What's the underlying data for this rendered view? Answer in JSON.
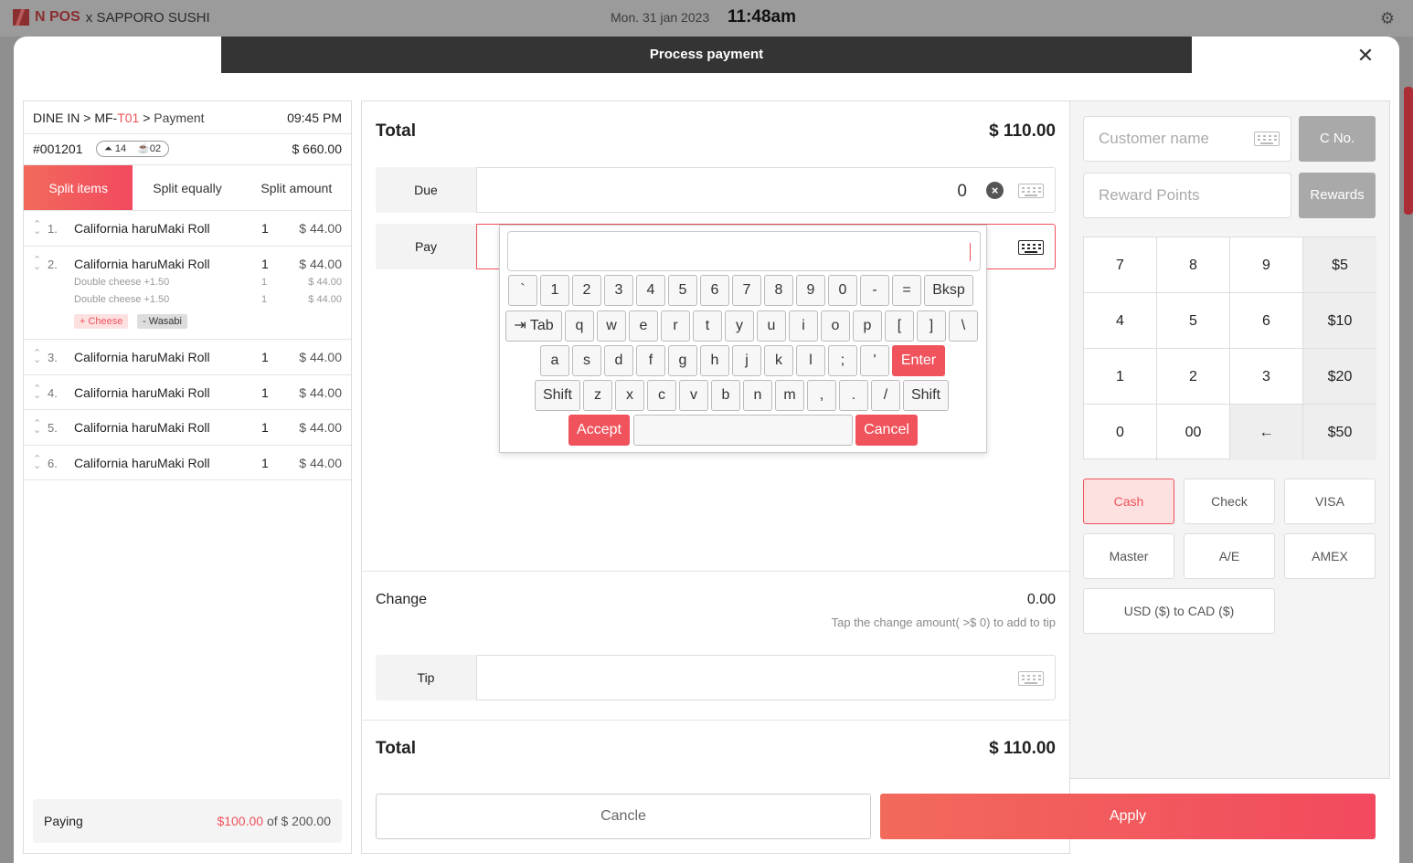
{
  "topbar": {
    "brand": "N POS",
    "restaurant": "x SAPPORO SUSHI",
    "date": "Mon. 31 jan 2023",
    "time": "11:48am"
  },
  "modal": {
    "title": "Process payment"
  },
  "order": {
    "breadcrumb": {
      "type": "DINE IN",
      "table_prefix": "MF-",
      "table": "T01",
      "page": "Payment"
    },
    "time": "09:45 PM",
    "number": "#001201",
    "guests": "14",
    "seats": "02",
    "total": "$ 660.00"
  },
  "tabs": [
    {
      "label": "Split items"
    },
    {
      "label": "Split equally"
    },
    {
      "label": "Split amount"
    }
  ],
  "items": [
    {
      "idx": "1.",
      "name": "California haruMaki Roll",
      "qty": "1",
      "price": "$ 44.00"
    },
    {
      "idx": "2.",
      "name": "California haruMaki Roll",
      "qty": "1",
      "price": "$ 44.00",
      "modifiers": [
        {
          "name": "Double cheese +1.50",
          "qty": "1",
          "price": "$ 44.00"
        },
        {
          "name": "Double cheese +1.50",
          "qty": "1",
          "price": "$ 44.00"
        }
      ],
      "tags": {
        "add": "+ Cheese",
        "remove": "- Wasabi"
      }
    },
    {
      "idx": "3.",
      "name": "California haruMaki Roll",
      "qty": "1",
      "price": "$ 44.00"
    },
    {
      "idx": "4.",
      "name": "California haruMaki Roll",
      "qty": "1",
      "price": "$ 44.00"
    },
    {
      "idx": "5.",
      "name": "California haruMaki Roll",
      "qty": "1",
      "price": "$ 44.00"
    },
    {
      "idx": "6.",
      "name": "California haruMaki Roll",
      "qty": "1",
      "price": "$ 44.00"
    }
  ],
  "paying": {
    "label": "Paying",
    "amount": "$100.00",
    "of": "of $ 200.00"
  },
  "payment": {
    "total_label": "Total",
    "total": "$ 110.00",
    "due_label": "Due",
    "due_value": "0",
    "pay_label": "Pay",
    "change_label": "Change",
    "change_value": "0.00",
    "change_hint": "Tap the change amount( >$ 0) to add to tip",
    "tip_label": "Tip",
    "total2_label": "Total",
    "total2": "$ 110.00"
  },
  "keyboard": {
    "row1": [
      "`",
      "1",
      "2",
      "3",
      "4",
      "5",
      "6",
      "7",
      "8",
      "9",
      "0",
      "-",
      "=",
      "Bksp"
    ],
    "row2": [
      "⇥ Tab",
      "q",
      "w",
      "e",
      "r",
      "t",
      "y",
      "u",
      "i",
      "o",
      "p",
      "[",
      "]",
      "\\"
    ],
    "row3": [
      "a",
      "s",
      "d",
      "f",
      "g",
      "h",
      "j",
      "k",
      "l",
      ";",
      "'",
      "Enter"
    ],
    "row4": [
      "Shift",
      "z",
      "x",
      "c",
      "v",
      "b",
      "n",
      "m",
      ",",
      ".",
      "/",
      "Shift"
    ],
    "accept": "Accept",
    "cancel": "Cancel"
  },
  "customer": {
    "name_placeholder": "Customer name",
    "cno_label": "C No.",
    "reward_placeholder": "Reward Points",
    "rewards_label": "Rewards"
  },
  "numpad": [
    [
      "7",
      "8",
      "9",
      "$5"
    ],
    [
      "4",
      "5",
      "6",
      "$10"
    ],
    [
      "1",
      "2",
      "3",
      "$20"
    ],
    [
      "0",
      "00",
      "←",
      "$50"
    ]
  ],
  "methods": [
    "Cash",
    "Check",
    "VISA",
    "Master",
    "A/E",
    "AMEX",
    "USD ($) to CAD ($)"
  ],
  "actions": {
    "cancel": "Cancle",
    "apply": "Apply"
  },
  "colors": {
    "accent": "#f0535c",
    "title_bar": "#343434"
  }
}
